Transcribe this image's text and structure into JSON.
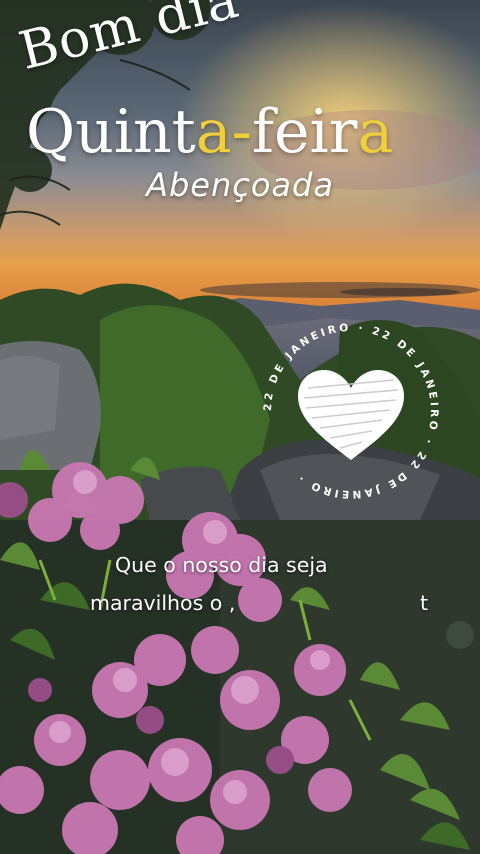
{
  "greeting": {
    "line1": "Bom dia",
    "day_parts": [
      "Quint",
      "a",
      "-",
      "feir",
      "a"
    ],
    "subtitle": "Abençoada"
  },
  "stamp": {
    "ring_text": "22 DE JANEIRO · 22 DE JANEIRO · 22 DE JANEIRO ·",
    "icon": "heart-icon"
  },
  "message": {
    "line1": "Que o nosso dia seja",
    "line2": "maravilhos o  ,",
    "tail": "t"
  },
  "colors": {
    "accent": "#f0cf3a",
    "text": "#ffffff"
  }
}
